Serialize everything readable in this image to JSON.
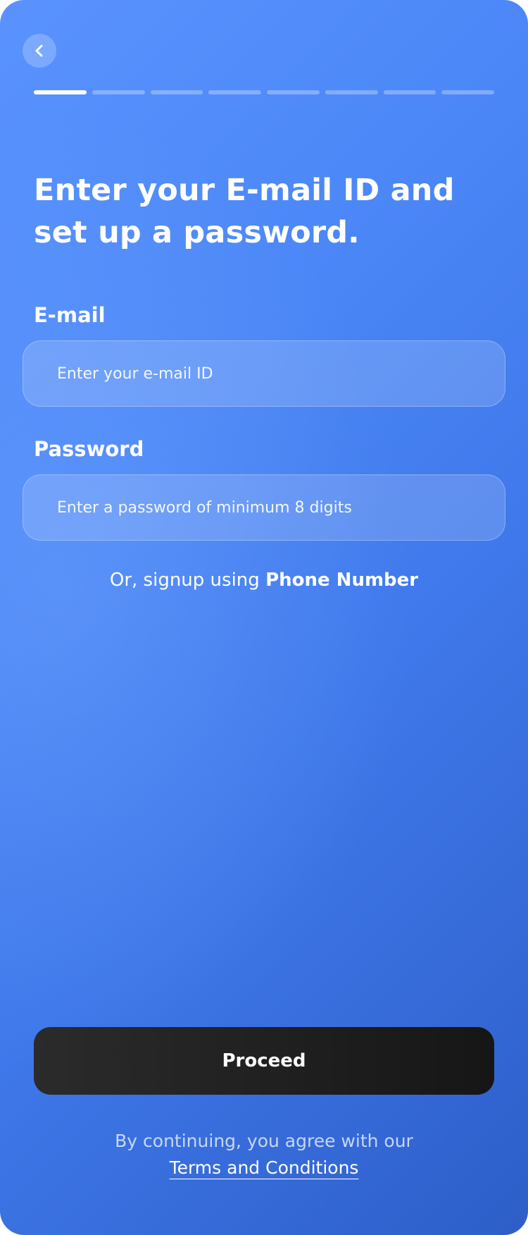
{
  "colors": {
    "background_start": "#5a93ff",
    "background_end": "#2d5ec8",
    "button_background": "#1c1c1c",
    "text": "#ffffff"
  },
  "header": {
    "back_icon": "chevron-left-icon",
    "progress": {
      "total_steps": 8,
      "current_step": 1
    }
  },
  "page": {
    "title": "Enter your E-mail ID and set up a password."
  },
  "form": {
    "email": {
      "label": "E-mail",
      "placeholder": "Enter your e-mail ID",
      "value": ""
    },
    "password": {
      "label": "Password",
      "placeholder": "Enter a password of minimum 8 digits",
      "value": ""
    }
  },
  "alt_signup": {
    "prefix": "Or, signup using",
    "link": "Phone Number"
  },
  "actions": {
    "proceed_label": "Proceed"
  },
  "terms": {
    "text": "By continuing, you agree with our",
    "link": "Terms and Conditions"
  }
}
